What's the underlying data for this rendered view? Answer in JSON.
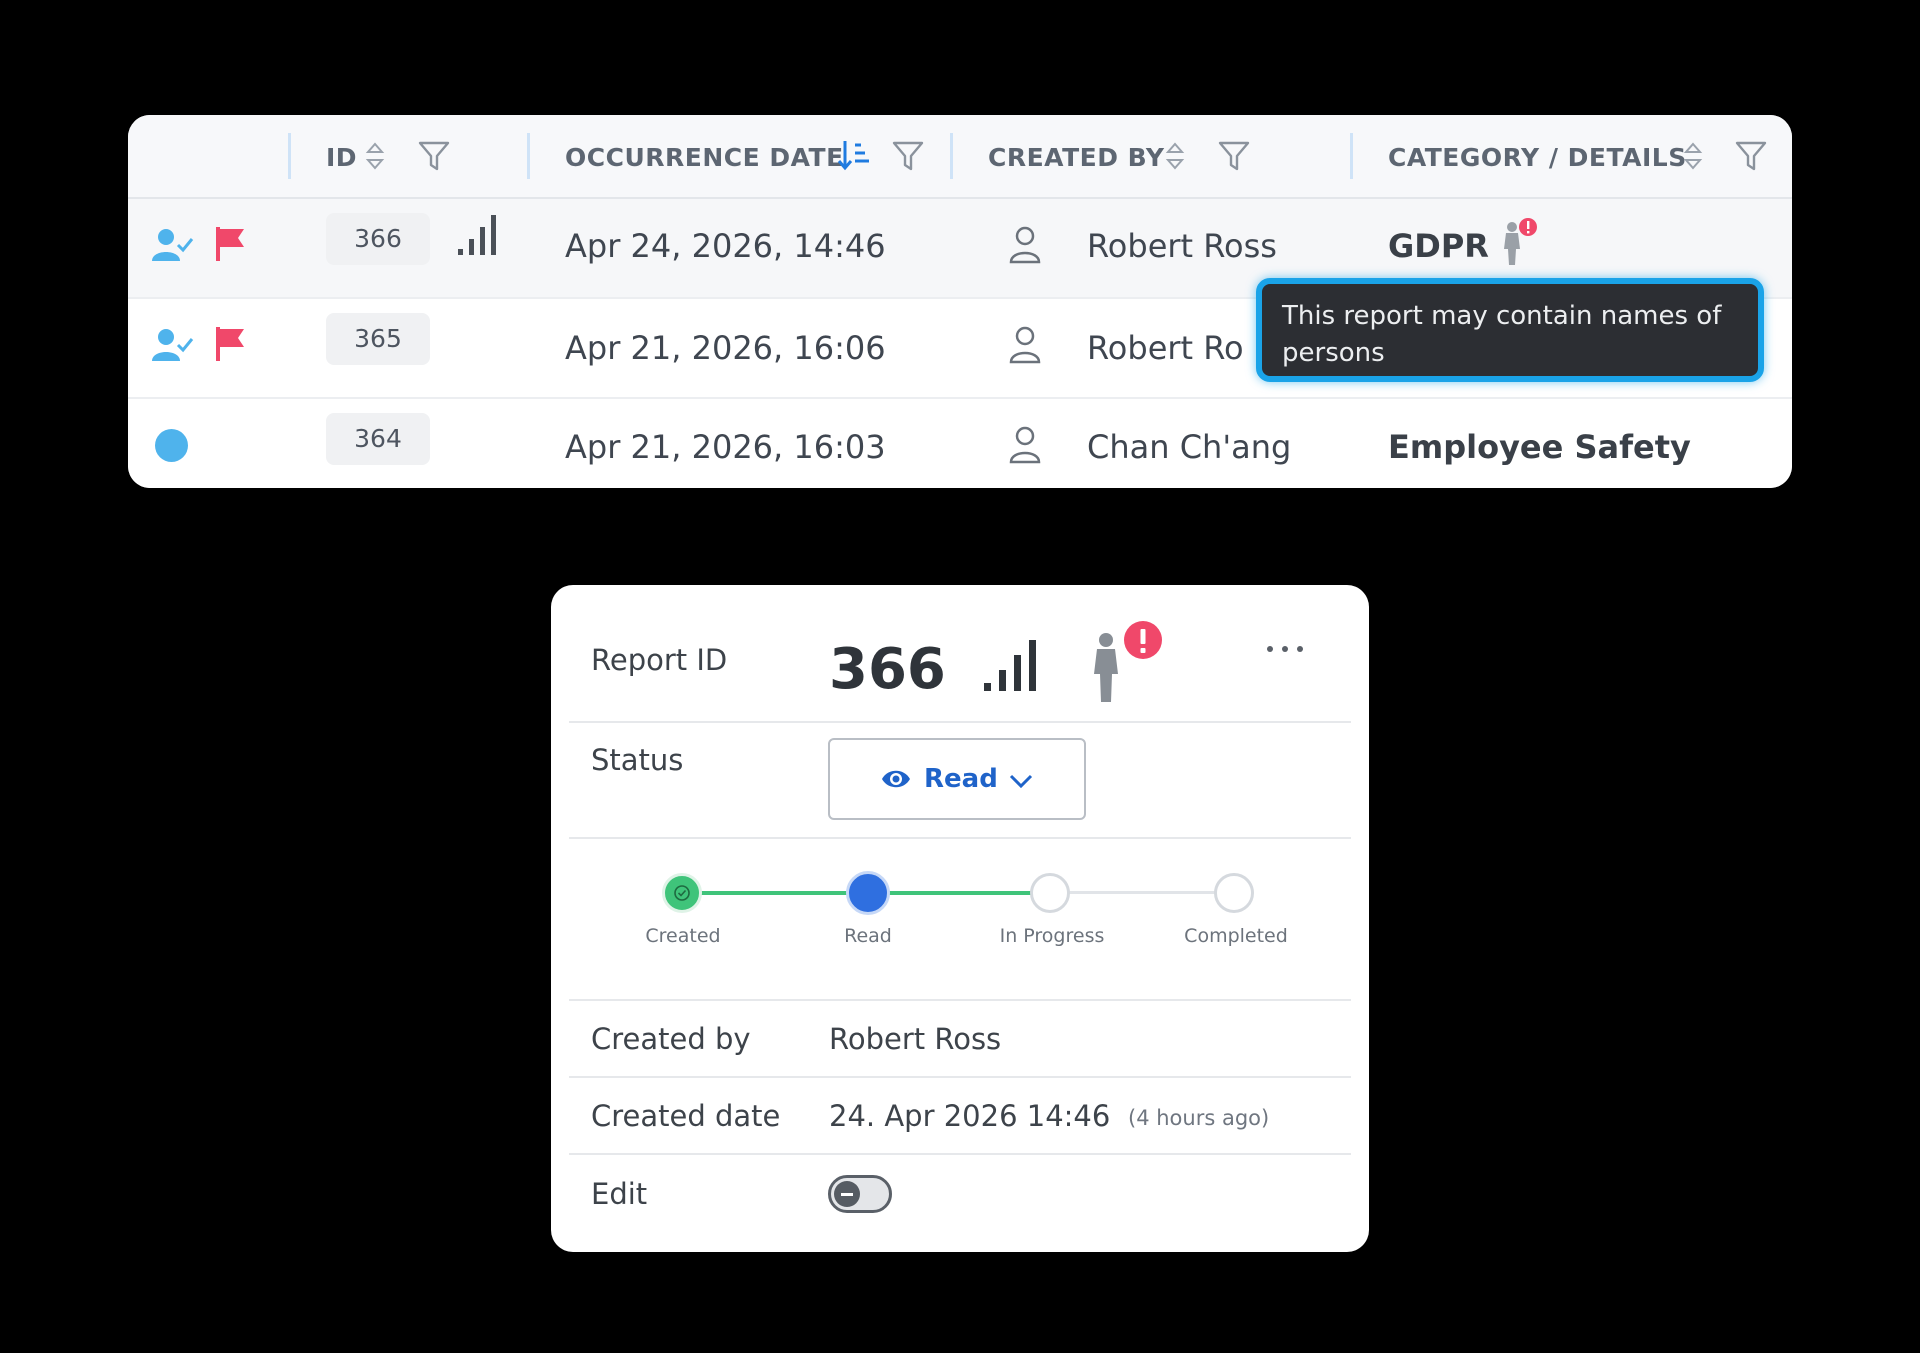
{
  "table": {
    "columns": [
      {
        "label": "ID"
      },
      {
        "label": "OCCURRENCE DATE"
      },
      {
        "label": "CREATED BY"
      },
      {
        "label": "CATEGORY / DETAILS"
      }
    ],
    "rows": [
      {
        "id": "366",
        "date": "Apr 24, 2026, 14:46",
        "created_by": "Robert Ross",
        "category": "GDPR"
      },
      {
        "id": "365",
        "date": "Apr 21, 2026, 16:06",
        "created_by": "Robert Ro",
        "category": ""
      },
      {
        "id": "364",
        "date": "Apr 21, 2026, 16:03",
        "created_by": "Chan Ch'ang",
        "category": "Employee Safety"
      }
    ],
    "tooltip": "This report may contain names of persons"
  },
  "detail": {
    "report_id_label": "Report ID",
    "report_id_value": "366",
    "status_label": "Status",
    "status_value": "Read",
    "steps": [
      "Created",
      "Read",
      "In Progress",
      "Completed"
    ],
    "current_step_index": 1,
    "created_by_label": "Created by",
    "created_by_value": "Robert Ross",
    "created_date_label": "Created date",
    "created_date_value": "24. Apr 2026 14:46",
    "created_date_relative": "(4 hours ago)",
    "edit_label": "Edit",
    "edit_enabled": false
  },
  "colors": {
    "accent_blue": "#1f63c9",
    "tooltip_border": "#1aa3e8",
    "flag_red": "#f0486a",
    "step_green": "#3fc47a",
    "user_icon_blue": "#4fb3ec"
  }
}
